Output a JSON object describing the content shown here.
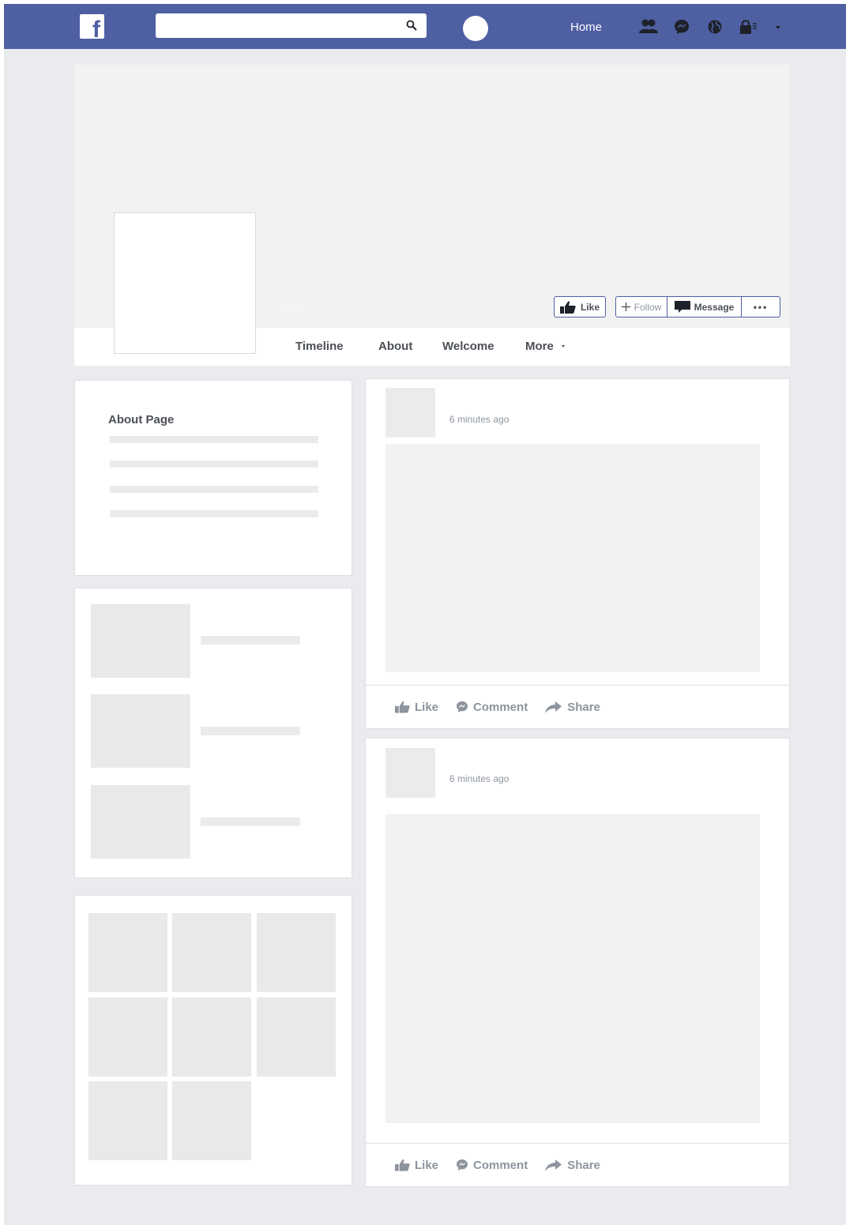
{
  "topbar": {
    "logo_letter": "f",
    "search_placeholder": "",
    "home_label": "Home"
  },
  "cover": {
    "page_name": "Grupo",
    "like_button": "Like",
    "follow_button": "Follow",
    "message_button": "Message",
    "more_button": "•••"
  },
  "tabs": [
    "Timeline",
    "About",
    "Welcome",
    "More"
  ],
  "about": {
    "title": "About Page"
  },
  "posts": [
    {
      "time": "6 minutes ago"
    },
    {
      "time": "6 minutes ago"
    }
  ],
  "actions": {
    "like": "Like",
    "comment": "Comment",
    "share": "Share"
  },
  "colors": {
    "brand": "#4e5fa2",
    "background": "#e9ebee",
    "placeholder": "#f1f1f1"
  }
}
